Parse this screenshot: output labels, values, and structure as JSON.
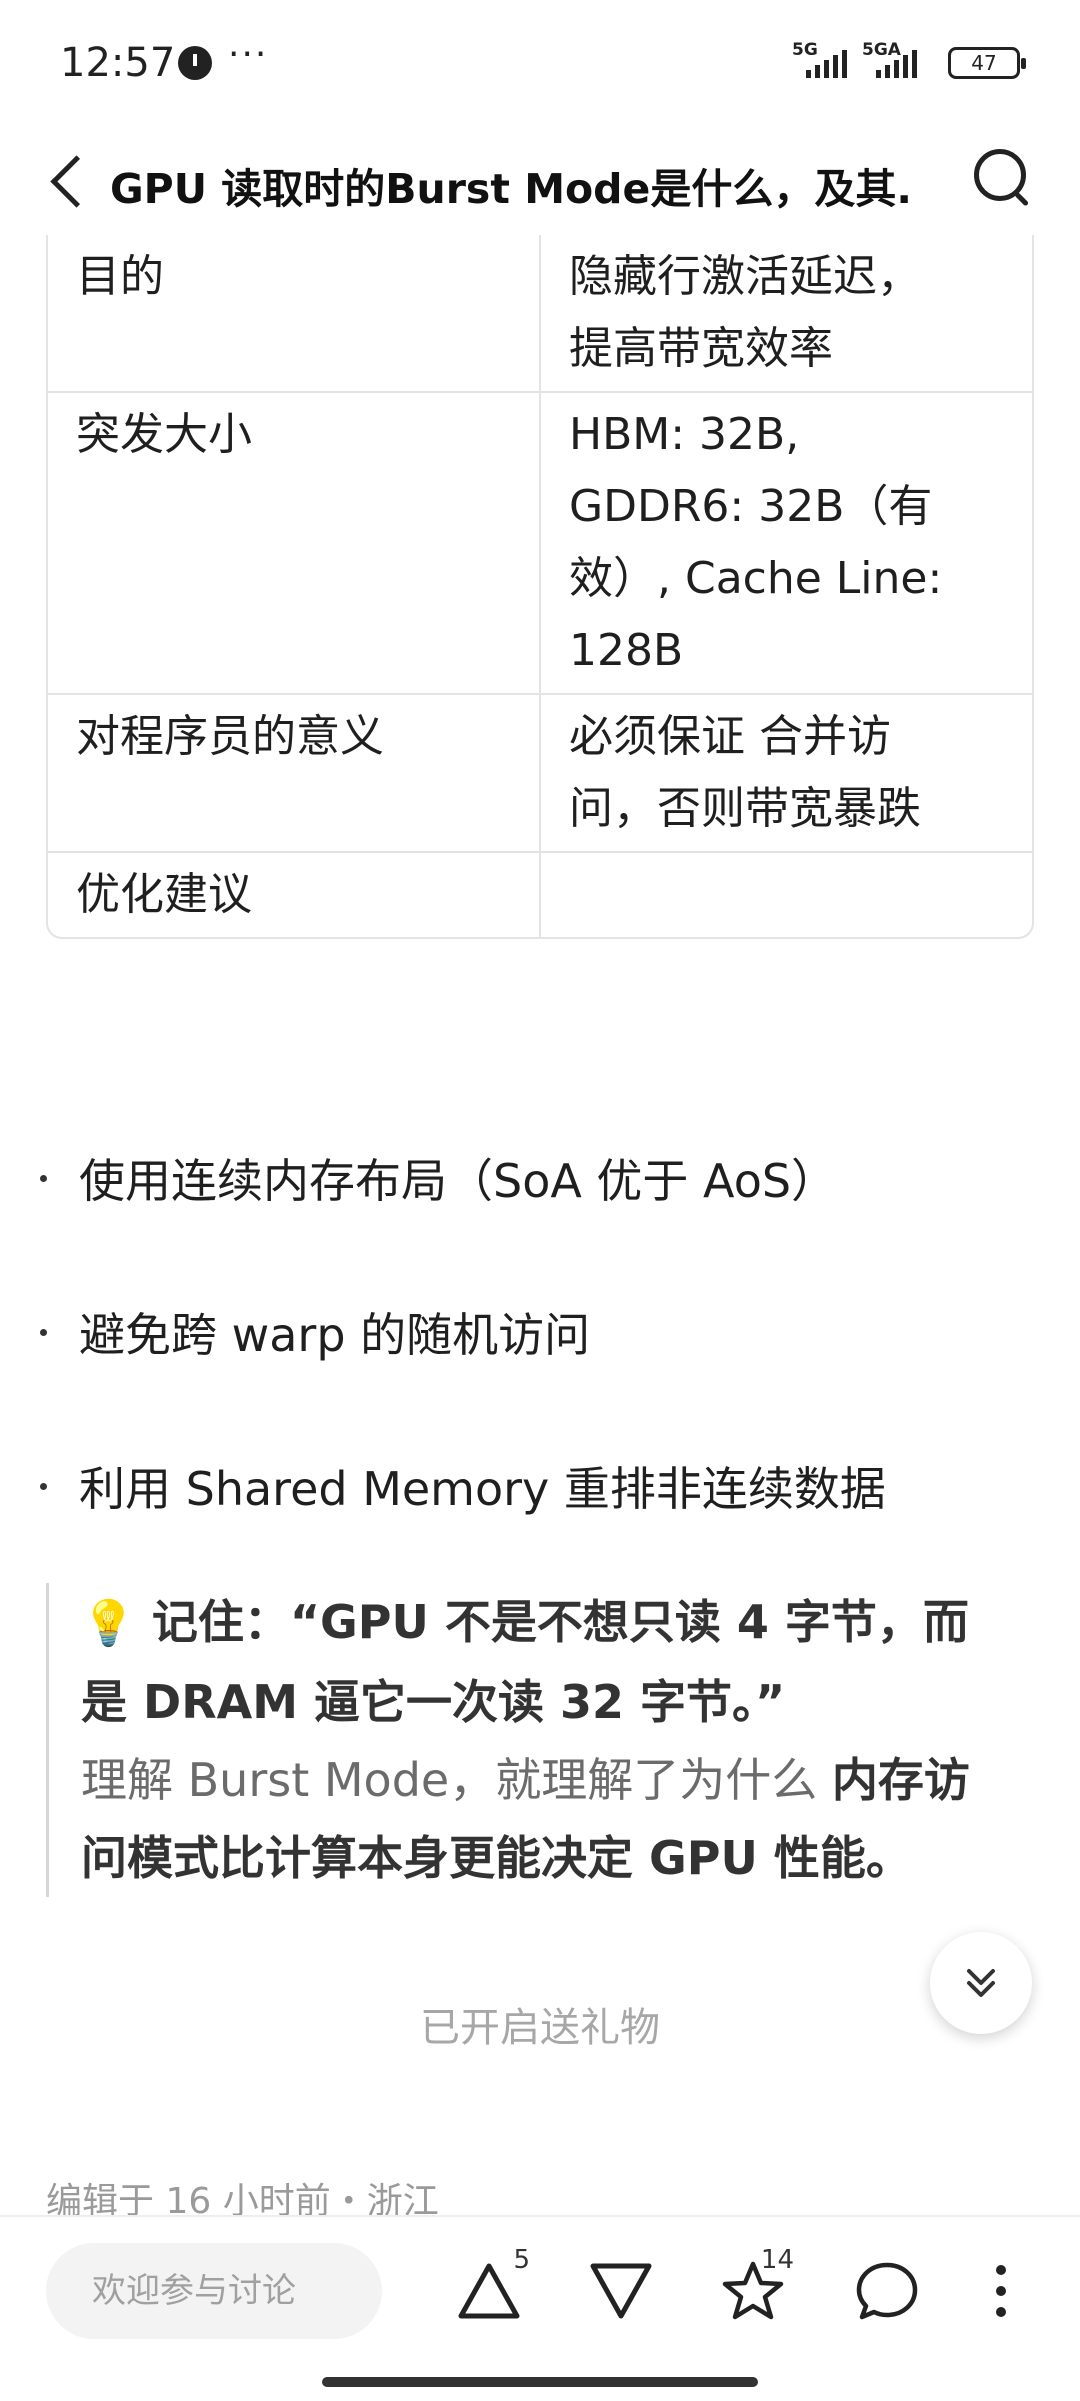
{
  "status_bar": {
    "time": "12:57",
    "more": "···",
    "signal1": "5G",
    "signal2": "5GA",
    "battery": "47"
  },
  "header": {
    "title": "GPU 读取时的Burst Mode是什么，及其..."
  },
  "table": {
    "rows": [
      {
        "key": "目的",
        "value": [
          "隐藏行激活延迟，",
          "提高带宽效率"
        ]
      },
      {
        "key": "突发大小",
        "value": [
          "HBM: 32B,",
          "GDDR6: 32B（有",
          "效）, Cache Line:",
          "128B"
        ]
      },
      {
        "key": "对程序员的意义",
        "value": [
          "必须保证 合并访",
          "问，否则带宽暴跌"
        ]
      },
      {
        "key": "优化建议",
        "value": [
          ""
        ]
      }
    ]
  },
  "bullets": [
    "使用连续内存布局（SoA 优于 AoS）",
    "避免跨 warp 的随机访问",
    "利用 Shared Memory 重排非连续数据"
  ],
  "quote": {
    "icon": "💡",
    "line1": "记住：“GPU 不是不想只读 4 字节，而",
    "line2": "是 DRAM 逼它一次读 32 字节。”",
    "line3_plain": "理解 Burst Mode，就理解了为什么 ",
    "line3_bold": "内存访",
    "line4_bold": "问模式比计算本身更能决定 GPU 性能。"
  },
  "gift_text": "已开启送礼物",
  "edit_meta": "编辑于 16 小时前・浙江",
  "bottom_bar": {
    "comment_placeholder": "欢迎参与讨论",
    "upvote_count": "5",
    "favorite_count": "14"
  },
  "icons": {
    "back": "back-chevron-icon",
    "search": "search-icon",
    "scroll": "double-chevron-down-icon",
    "upvote": "triangle-up-icon",
    "downvote": "triangle-down-icon",
    "favorite": "star-icon",
    "comment": "comment-bubble-icon",
    "more": "vertical-dots-icon"
  }
}
